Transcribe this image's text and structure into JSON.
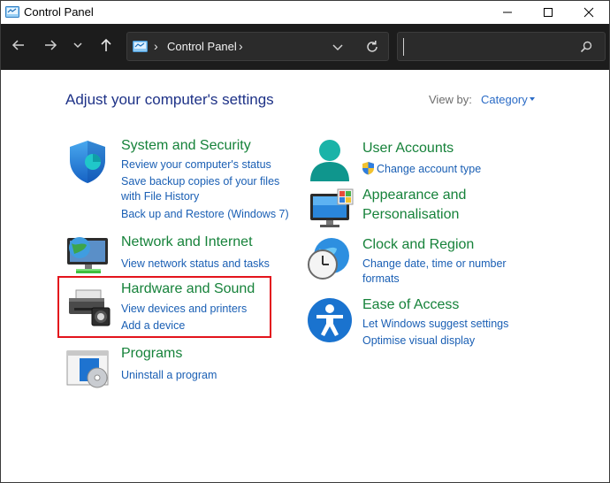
{
  "window": {
    "title": "Control Panel",
    "minimize_icon": "minimize-icon",
    "maximize_icon": "maximize-icon",
    "close_icon": "close-icon"
  },
  "navigation": {
    "back_icon": "arrow-left-icon",
    "forward_icon": "arrow-right-icon",
    "recent_icon": "chevron-down-icon",
    "up_icon": "arrow-up-icon"
  },
  "address_bar": {
    "location_icon": "control-panel-icon",
    "separator": "›",
    "crumb": "Control Panel",
    "dropdown_icon": "chevron-down-icon",
    "refresh_icon": "refresh-icon"
  },
  "search": {
    "value": "",
    "placeholder": "",
    "icon": "search-icon"
  },
  "content": {
    "heading": "Adjust your computer's settings",
    "view_by_label": "View by:",
    "view_by_value": "Category"
  },
  "categories_left": [
    {
      "icon": "shield-icon",
      "title": "System and Security",
      "links": [
        "Review your computer's status",
        "Save backup copies of your files",
        "with File History",
        "Back up and Restore (Windows 7)"
      ]
    },
    {
      "icon": "network-globe-icon",
      "title": "Network and Internet",
      "links": [
        "View network status and tasks"
      ]
    },
    {
      "icon": "printer-icon",
      "title": "Hardware and Sound",
      "links": [
        "View devices and printers",
        "Add a device"
      ]
    },
    {
      "icon": "programs-disc-icon",
      "title": "Programs",
      "links": [
        "Uninstall a program"
      ]
    }
  ],
  "categories_right": [
    {
      "icon": "user-icon",
      "title": "User Accounts",
      "links": [
        "Change account type"
      ],
      "link_icon": "uac-shield-icon"
    },
    {
      "icon": "monitor-palette-icon",
      "title_line1": "Appearance and",
      "title_line2": "Personalisation"
    },
    {
      "icon": "clock-globe-icon",
      "title": "Clock and Region",
      "links": [
        "Change date, time or number",
        "formats"
      ]
    },
    {
      "icon": "accessibility-icon",
      "title": "Ease of Access",
      "links": [
        "Let Windows suggest settings",
        "Optimise visual display"
      ]
    }
  ],
  "colors": {
    "category_title": "#16823a",
    "link": "#1a5fb4",
    "heading": "#1e3287",
    "highlight_border": "#e3141c",
    "nav_background": "#1c1c1c"
  }
}
